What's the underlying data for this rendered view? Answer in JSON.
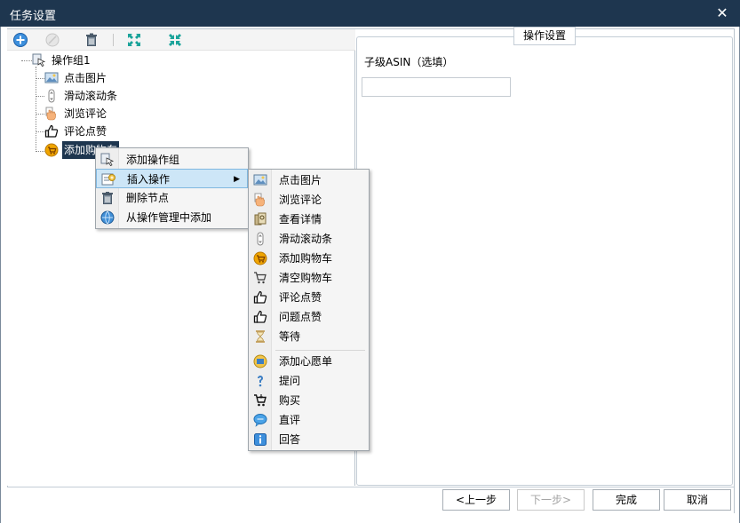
{
  "window": {
    "title": "任务设置",
    "close_glyph": "✕"
  },
  "toolbar": {
    "buttons": [
      {
        "name": "add-icon",
        "color": "#2a7fd3"
      },
      {
        "name": "disabled-circle-icon",
        "color": "#c6c6c6"
      },
      {
        "name": "trash-icon",
        "color": "#4a5a6a"
      },
      {
        "name": "expand-icon",
        "color": "#1aa39a"
      },
      {
        "name": "collapse-icon",
        "color": "#1aa39a"
      }
    ]
  },
  "tree": {
    "root": "操作组1",
    "children": [
      "点击图片",
      "滑动滚动条",
      "浏览评论",
      "评论点赞",
      "添加购物车"
    ]
  },
  "context_menu": {
    "items": [
      "添加操作组",
      "插入操作",
      "删除节点",
      "从操作管理中添加"
    ],
    "submenu_arrow": "▶"
  },
  "submenu": {
    "group1": [
      "点击图片",
      "浏览评论",
      "查看详情",
      "滑动滚动条",
      "添加购物车",
      "清空购物车",
      "评论点赞",
      "问题点赞",
      "等待"
    ],
    "group2": [
      "添加心愿单",
      "提问",
      "购买",
      "直评",
      "回答"
    ]
  },
  "right_panel": {
    "caption": "操作设置",
    "field_label": "子级ASIN（选填）",
    "field_value": ""
  },
  "footer": {
    "prev": "<上一步",
    "next": "下一步>",
    "finish": "完成",
    "cancel": "取消"
  },
  "colors": {
    "titlebar": "#1e364f",
    "selection": "#1e364f",
    "menu_hover": "#cde6f7"
  }
}
